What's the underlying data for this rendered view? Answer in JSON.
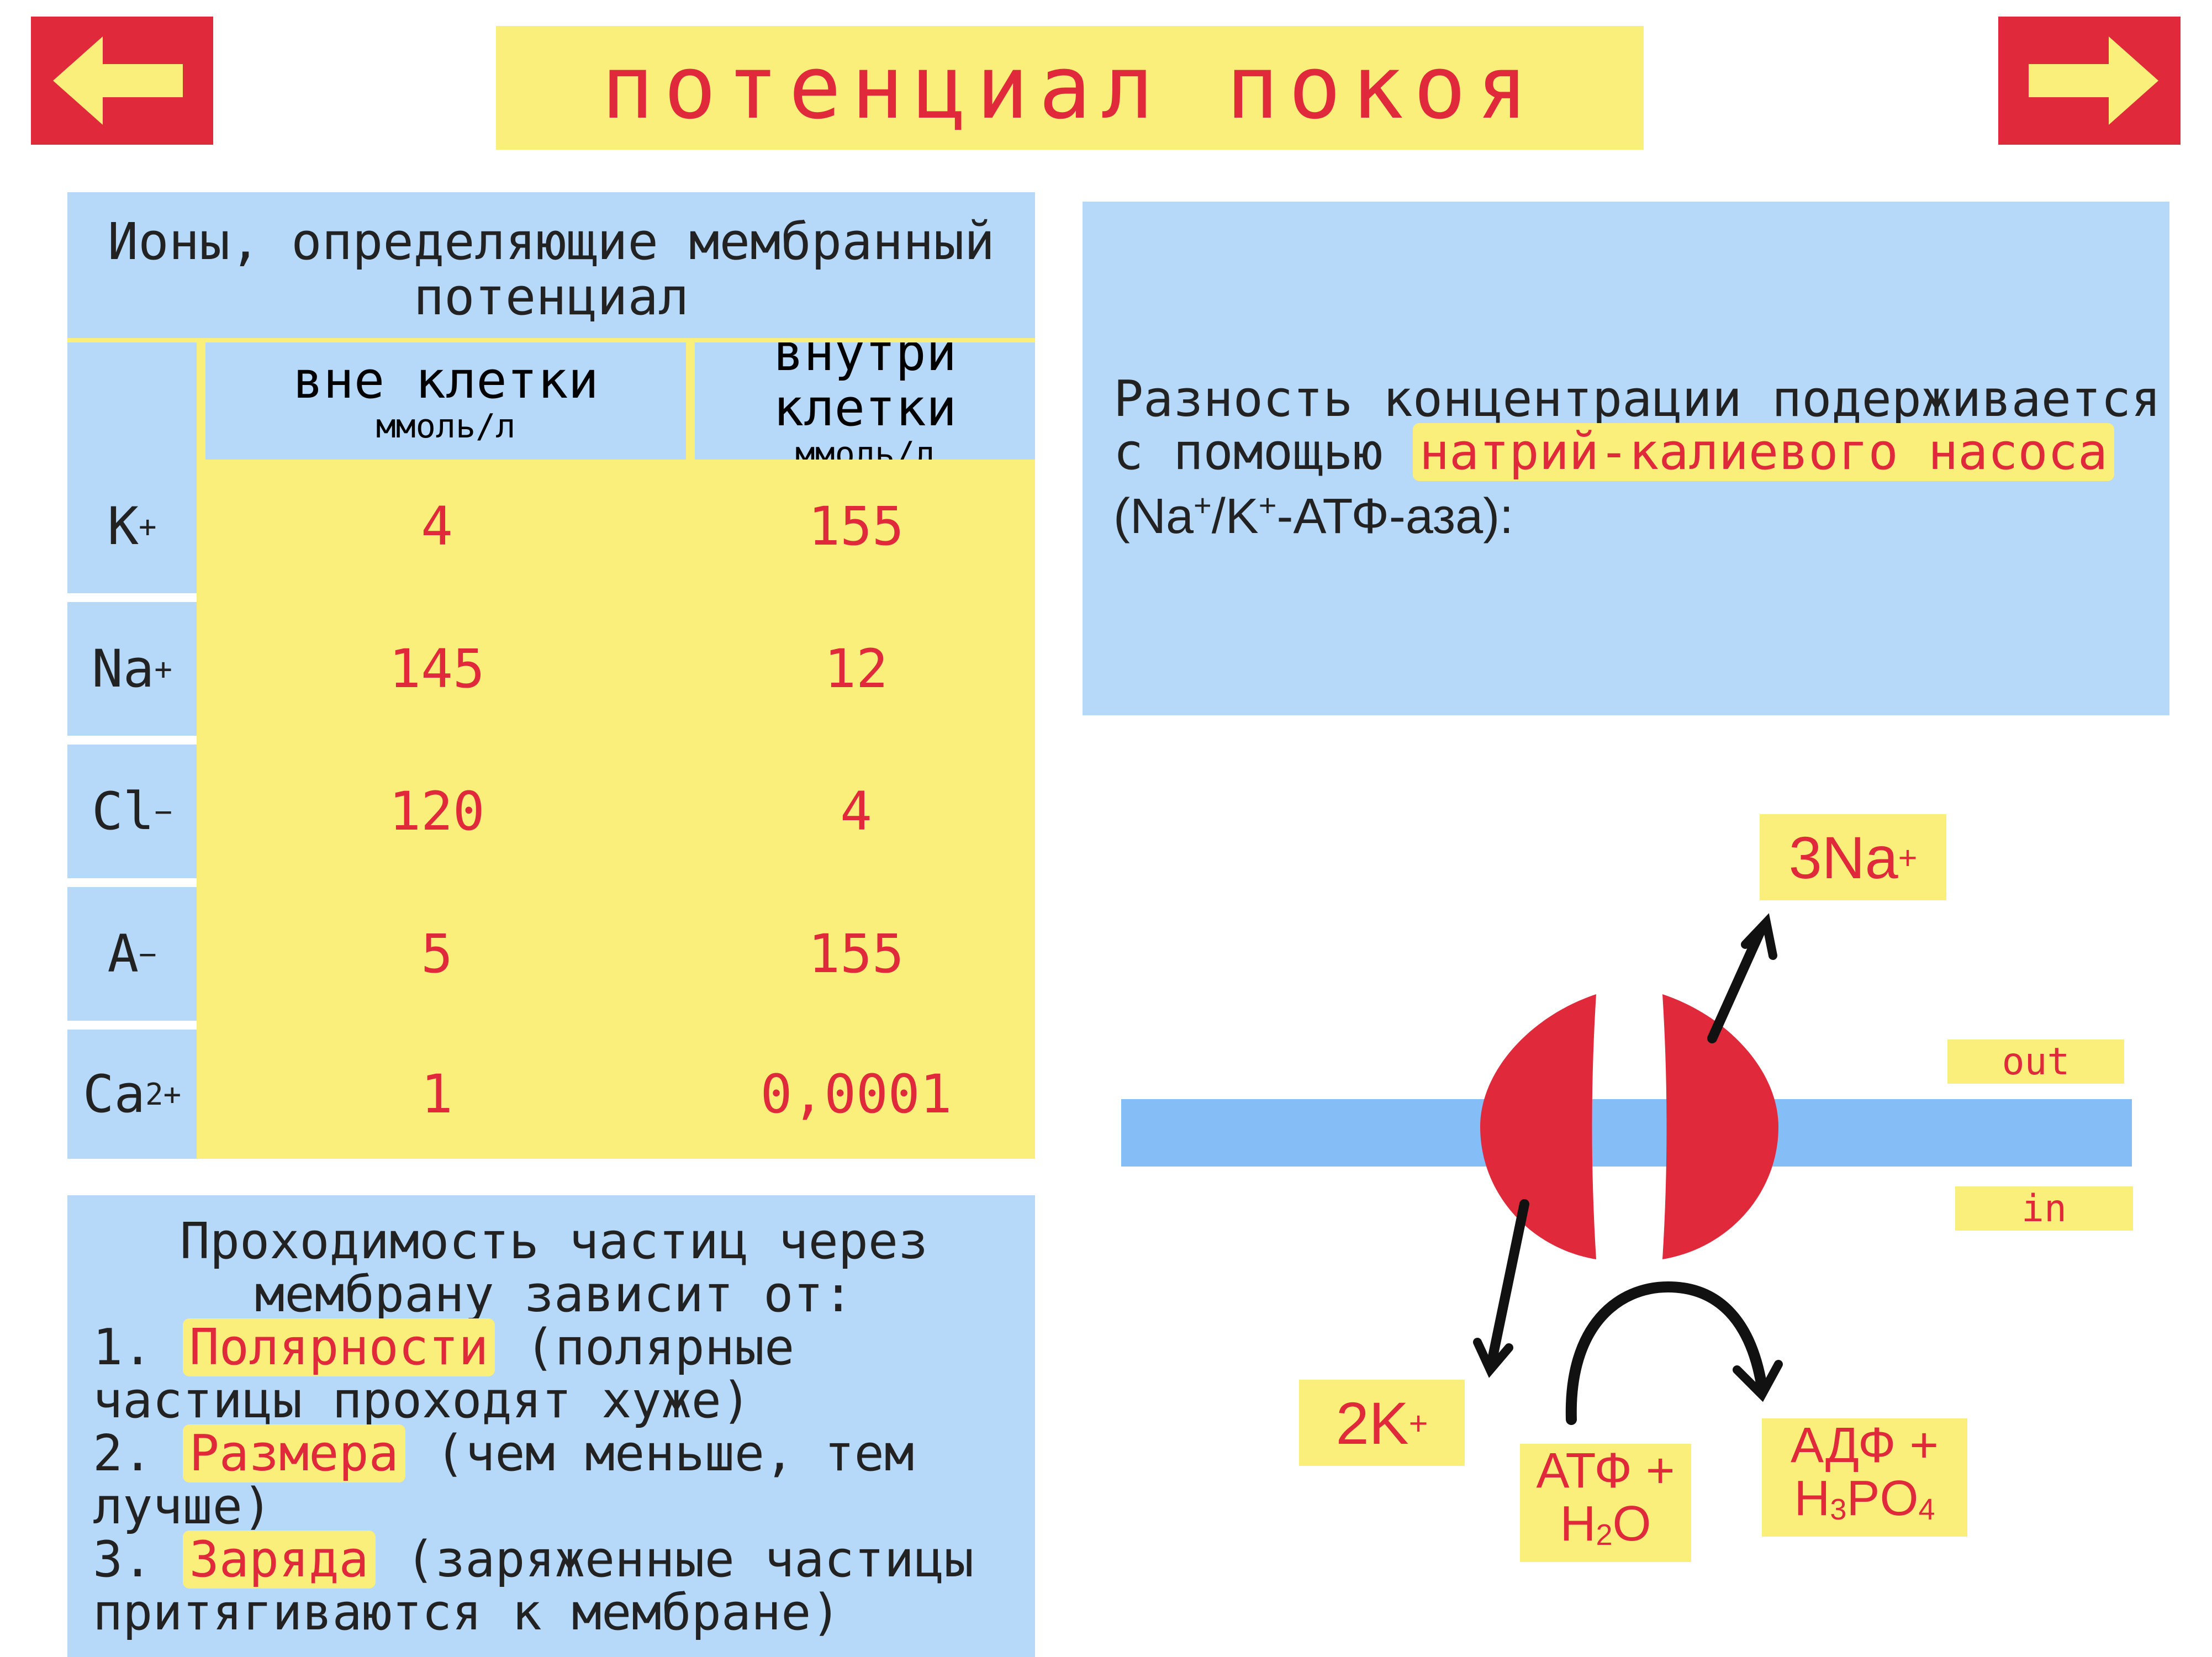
{
  "nav": {
    "prev_icon": "arrow-left-icon",
    "next_icon": "arrow-right-icon"
  },
  "title": "потенциал покоя",
  "ions_table": {
    "title": "Ионы, определяющие мембранный потенциал",
    "columns": [
      {
        "label": "вне клетки",
        "unit": "ммоль/л"
      },
      {
        "label": "внутри клетки",
        "unit": "ммоль/л"
      }
    ],
    "rows": [
      {
        "ion": "K",
        "charge": "+",
        "outside": "4",
        "inside": "155"
      },
      {
        "ion": "Na",
        "charge": "+",
        "outside": "145",
        "inside": "12"
      },
      {
        "ion": "Cl",
        "charge": "−",
        "outside": "120",
        "inside": "4"
      },
      {
        "ion": "A",
        "charge": "−",
        "outside": "5",
        "inside": "155"
      },
      {
        "ion": "Ca",
        "charge": "2+",
        "outside": "1",
        "inside": "0,0001"
      }
    ]
  },
  "permeability": {
    "title": "Проходимость частиц через мембрану зависит от:",
    "items": [
      {
        "num": "1.",
        "key": "Полярности",
        "rest": "(полярные частицы проходят хуже)"
      },
      {
        "num": "2.",
        "key": "Размера",
        "rest": "(чем меньше, тем лучше)"
      },
      {
        "num": "3.",
        "key": "Заряда",
        "rest": "(заряженные частицы притягиваются к мембране)"
      }
    ]
  },
  "pump": {
    "text_before": "Разность концентрации подерживается с помощью",
    "highlight": "натрий-калиевого насоса",
    "formula_a": "(Na",
    "formula_sup1": "+",
    "formula_b": "/K",
    "formula_sup2": "+",
    "formula_c": "-АТФ-аза):"
  },
  "diagram": {
    "na_label": "3Na",
    "na_charge": "+",
    "k_label": "2K",
    "k_charge": "+",
    "out_label": "out",
    "in_label": "in",
    "atp_line1": "АТФ +",
    "atp_h": "H",
    "atp_2": "2",
    "atp_o": "O",
    "adp_line1": "АДФ +",
    "adp_h": "H",
    "adp_3": "3",
    "adp_po": "PO",
    "adp_4": "4"
  },
  "colors": {
    "red": "#e0293a",
    "yellow": "#fbef7b",
    "blue": "#b7d9f9",
    "membrane": "#85bdf6"
  }
}
